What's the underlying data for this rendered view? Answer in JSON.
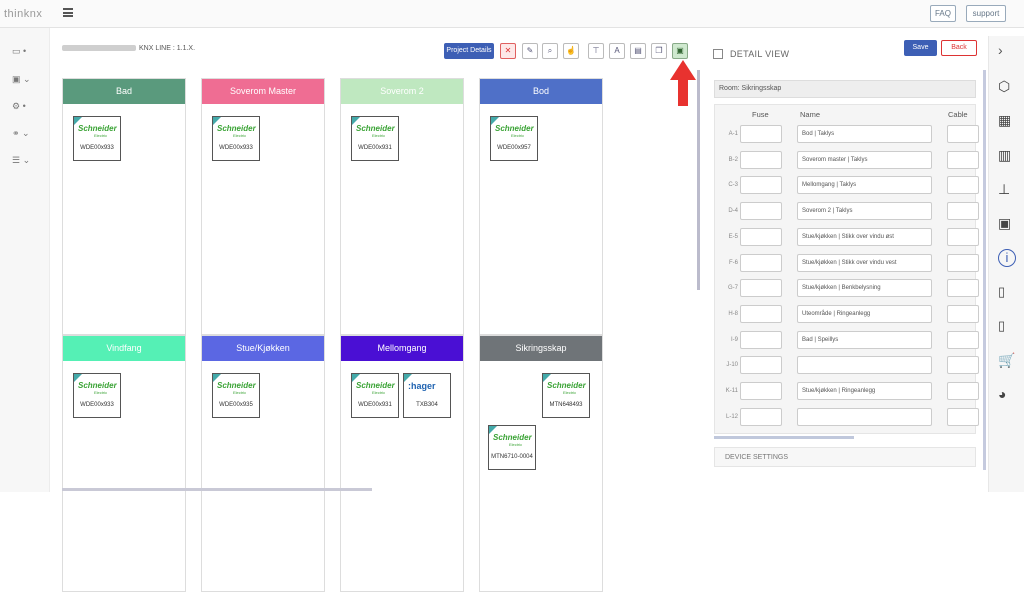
{
  "app": {
    "logo": "thinknx"
  },
  "header": {
    "faq": "FAQ",
    "support": "support"
  },
  "leftnav": {
    "items": [
      "dashboard",
      "user",
      "settings",
      "links",
      "list"
    ]
  },
  "board": {
    "title": "KNX LINE : 1.1.X."
  },
  "toolbar": {
    "project_details": "Project Details",
    "close": "✕",
    "text_icon": "A"
  },
  "rooms": [
    {
      "name": "Bad",
      "color": "#5a9a7d",
      "devices": [
        {
          "brand": "Schneider",
          "model": "WDE00x933"
        }
      ]
    },
    {
      "name": "Soverom Master",
      "color": "#ef6d93",
      "devices": [
        {
          "brand": "Schneider",
          "model": "WDE00x933"
        }
      ]
    },
    {
      "name": "Soverom 2",
      "color": "#bfe8c0",
      "devices": [
        {
          "brand": "Schneider",
          "model": "WDE00x931"
        }
      ]
    },
    {
      "name": "Bod",
      "color": "#4f70c8",
      "devices": [
        {
          "brand": "Schneider",
          "model": "WDE00x957"
        }
      ]
    },
    {
      "name": "Vindfang",
      "color": "#55f0b5",
      "devices": [
        {
          "brand": "Schneider",
          "model": "WDE00x933"
        }
      ]
    },
    {
      "name": "Stue/Kjøkken",
      "color": "#5b67e3",
      "devices": [
        {
          "brand": "Schneider",
          "model": "WDE00x935"
        }
      ]
    },
    {
      "name": "Mellomgang",
      "color": "#4a0fd4",
      "devices": [
        {
          "brand": "Schneider",
          "model": "WDE00x931"
        },
        {
          "brand": ":hager",
          "model": "TXB304"
        }
      ]
    },
    {
      "name": "Sikringsskap",
      "color": "#6f7478",
      "devices": [
        {
          "brand": "Schneider",
          "model": "MTN648493"
        },
        {
          "brand": "Schneider",
          "model": "MTN6710-0004"
        }
      ]
    }
  ],
  "detail": {
    "title": "DETAIL VIEW",
    "save": "Save",
    "back": "Back",
    "room_label": "Room:  Sikringsskap",
    "columns": {
      "fuse": "Fuse",
      "name": "Name",
      "cable": "Cable"
    },
    "rows": [
      {
        "id": "A-1",
        "name": "Bod | Taklys"
      },
      {
        "id": "B-2",
        "name": "Soverom master | Taklys"
      },
      {
        "id": "C-3",
        "name": "Mellomgang | Taklys"
      },
      {
        "id": "D-4",
        "name": "Soverom 2 | Taklys"
      },
      {
        "id": "E-5",
        "name": "Stue/kjøkken | Stikk over vindu øst"
      },
      {
        "id": "F-6",
        "name": "Stue/kjøkken | Stikk over vindu vest"
      },
      {
        "id": "G-7",
        "name": "Stue/kjøkken | Benkbelysning"
      },
      {
        "id": "H-8",
        "name": "Uteområde | Ringeanlegg"
      },
      {
        "id": "I-9",
        "name": "Bad | Speillys"
      },
      {
        "id": "J-10",
        "name": ""
      },
      {
        "id": "K-11",
        "name": "Stue/kjøkken | Ringeanlegg"
      },
      {
        "id": "L-12",
        "name": ""
      }
    ],
    "device_settings": "DEVICE SETTINGS"
  },
  "colors": {
    "accent": "#3d5fb5",
    "arrow": "#e8322f"
  }
}
